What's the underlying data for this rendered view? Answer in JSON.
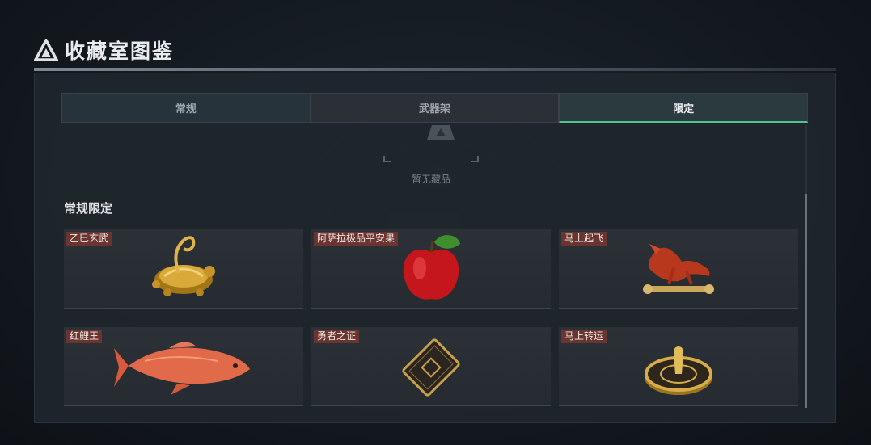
{
  "page": {
    "title": "收藏室图鉴"
  },
  "tabs": [
    {
      "label": "常规"
    },
    {
      "label": "武器架"
    },
    {
      "label": "限定",
      "active": true
    }
  ],
  "empty_state": {
    "text": "暂无藏品"
  },
  "section": {
    "title": "常规限定"
  },
  "items": [
    {
      "name": "乙巳玄武",
      "icon": "golden-tortoise-snake-icon"
    },
    {
      "name": "阿萨拉极品平安果",
      "icon": "red-apple-icon"
    },
    {
      "name": "马上起飞",
      "icon": "red-horse-statue-icon"
    },
    {
      "name": "红鲤王",
      "icon": "red-carp-icon"
    },
    {
      "name": "勇者之证",
      "icon": "gold-card-icon"
    },
    {
      "name": "马上转运",
      "icon": "golden-wheel-icon"
    }
  ],
  "colors": {
    "accent": "#4fc48f",
    "name_tag": "#6a3530"
  }
}
